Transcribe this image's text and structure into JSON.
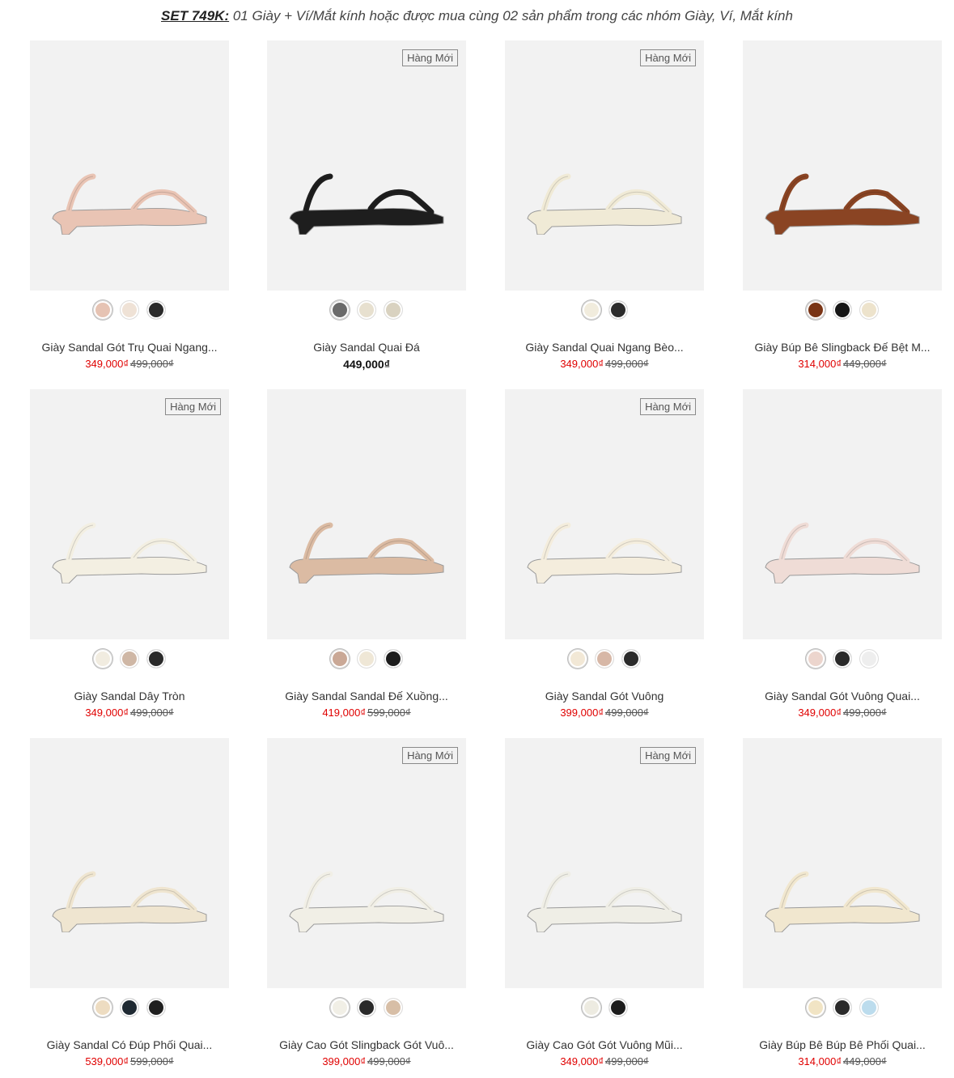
{
  "banner": {
    "strong": "SET 749K:",
    "text": " 01 Giày + Ví/Mắt kính hoặc được mua cùng 02 sản phẩm trong các nhóm Giày, Ví, Mắt kính"
  },
  "products": [
    {
      "name": "Giày Sandal Gót Trụ Quai Ngang...",
      "price": "349,000₫",
      "old_price": "499,000₫",
      "badge": "",
      "shoe_color": "#e9c4b4",
      "swatches": [
        "#e6c3b3",
        "#efe2d6",
        "#2a2a2a"
      ]
    },
    {
      "name": "Giày Sandal Quai Đá",
      "price": "449,000₫",
      "old_price": "",
      "badge": "Hàng Mới",
      "shoe_color": "#1e1e1e",
      "swatches": [
        "#6b6b6b",
        "#e7e0cf",
        "#d9d2c0"
      ]
    },
    {
      "name": "Giày Sandal Quai Ngang Bèo...",
      "price": "349,000₫",
      "old_price": "499,000₫",
      "badge": "Hàng Mới",
      "shoe_color": "#f0ead6",
      "swatches": [
        "#f1ecdd",
        "#2c2c2c"
      ]
    },
    {
      "name": "Giày Búp Bê Slingback Đế Bệt M...",
      "price": "314,000₫",
      "old_price": "449,000₫",
      "badge": "",
      "shoe_color": "#8a4423",
      "swatches": [
        "#7a3415",
        "#161616",
        "#ede3cc"
      ]
    },
    {
      "name": "Giày Sandal Dây Tròn",
      "price": "349,000₫",
      "old_price": "499,000₫",
      "badge": "Hàng Mới",
      "shoe_color": "#f3efe2",
      "swatches": [
        "#f1ece0",
        "#cfb7a5",
        "#2a2a2a"
      ]
    },
    {
      "name": "Giày Sandal Sandal Đế Xuồng...",
      "price": "419,000₫",
      "old_price": "599,000₫",
      "badge": "",
      "shoe_color": "#dbbba3",
      "swatches": [
        "#caa896",
        "#efe7d6",
        "#1c1c1c"
      ]
    },
    {
      "name": "Giày Sandal Gót Vuông",
      "price": "399,000₫",
      "old_price": "499,000₫",
      "badge": "Hàng Mới",
      "shoe_color": "#f4eddd",
      "swatches": [
        "#f2e8d6",
        "#d7b7a6",
        "#2b2b2b"
      ]
    },
    {
      "name": "Giày Sandal Gót Vuông Quai...",
      "price": "349,000₫",
      "old_price": "499,000₫",
      "badge": "",
      "shoe_color": "#efdcd6",
      "swatches": [
        "#ecd5cd",
        "#2a2a2a",
        "#eeeeee"
      ]
    },
    {
      "name": "Giày Sandal Có Đúp Phối Quai...",
      "price": "539,000₫",
      "old_price": "599,000₫",
      "badge": "",
      "shoe_color": "#efe5d0",
      "swatches": [
        "#eddcc1",
        "#1f2a33",
        "#1f1f1f"
      ]
    },
    {
      "name": "Giày Cao Gót Slingback Gót Vuô...",
      "price": "399,000₫",
      "old_price": "499,000₫",
      "badge": "Hàng Mới",
      "shoe_color": "#f1efe6",
      "swatches": [
        "#f1efe6",
        "#2a2a2a",
        "#d7bea6"
      ]
    },
    {
      "name": "Giày Cao Gót Gót Vuông Mũi...",
      "price": "349,000₫",
      "old_price": "499,000₫",
      "badge": "Hàng Mới",
      "shoe_color": "#efeee6",
      "swatches": [
        "#edebe1",
        "#1c1c1c"
      ]
    },
    {
      "name": "Giày Búp Bê Búp Bê Phối Quai...",
      "price": "314,000₫",
      "old_price": "449,000₫",
      "badge": "",
      "shoe_color": "#f1e7cf",
      "swatches": [
        "#f1e4c4",
        "#2a2a2a",
        "#bcdced"
      ]
    }
  ]
}
